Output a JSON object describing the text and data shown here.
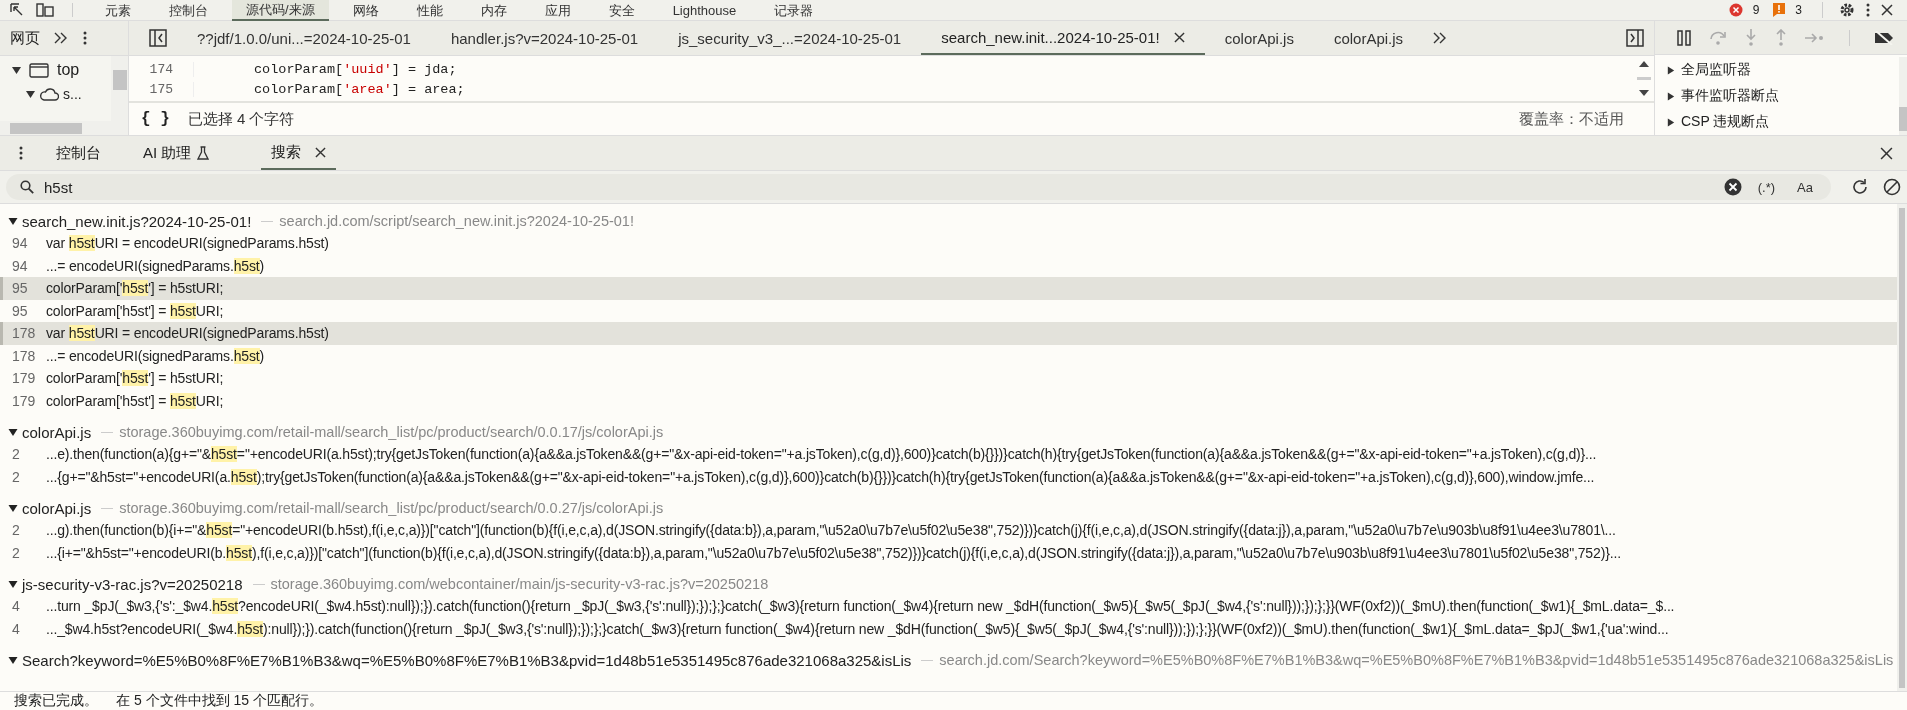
{
  "main_tabs": [
    {
      "label": "元素",
      "selected": false
    },
    {
      "label": "控制台",
      "selected": false
    },
    {
      "label": "源代码/来源",
      "selected": true
    },
    {
      "label": "网络",
      "selected": false
    },
    {
      "label": "性能",
      "selected": false
    },
    {
      "label": "内存",
      "selected": false
    },
    {
      "label": "应用",
      "selected": false
    },
    {
      "label": "安全",
      "selected": false
    },
    {
      "label": "Lighthouse",
      "selected": false
    },
    {
      "label": "记录器",
      "selected": false
    }
  ],
  "counters": {
    "errors": "9",
    "warnings": "3"
  },
  "navigator": {
    "tab": "网页",
    "tree": [
      {
        "label": "top",
        "expanded": true,
        "children": [
          {
            "label": "s...",
            "expanded": true
          }
        ]
      }
    ]
  },
  "file_tabs": [
    {
      "label": "??jdf/1.0.0/uni...=2024-10-25-01",
      "selected": false
    },
    {
      "label": "handler.js?v=2024-10-25-01",
      "selected": false
    },
    {
      "label": "js_security_v3_...=2024-10-25-01",
      "selected": false
    },
    {
      "label": "search_new.init...2024-10-25-01!",
      "selected": true
    },
    {
      "label": "colorApi.js",
      "selected": false
    },
    {
      "label": "colorApi.js",
      "selected": false
    }
  ],
  "editor": {
    "lines": [
      {
        "number": "174",
        "pre": "colorParam[",
        "str": "'uuid'",
        "post": "] = jda;"
      },
      {
        "number": "175",
        "pre": "colorParam[",
        "str": "'area'",
        "post": "] = area;"
      }
    ],
    "format_button": "{ }",
    "selection": "已选择 4 个字符",
    "coverage": "覆盖率：不适用"
  },
  "breakpoints": [
    {
      "label": "全局监听器",
      "expanded": false
    },
    {
      "label": "事件监听器断点",
      "expanded": false
    },
    {
      "label": "CSP 违规断点",
      "expanded": false
    }
  ],
  "drawer_tabs": [
    {
      "label": "控制台",
      "selected": false
    },
    {
      "label": "AI 助理",
      "selected": false
    },
    {
      "label": "搜索",
      "selected": true
    }
  ],
  "search": {
    "value": "h5st",
    "regex": "(.*)",
    "match_case": "Aa"
  },
  "results": [
    {
      "file": "search_new.init.js?2024-10-25-01!",
      "url": "search.jd.com/script/search_new.init.js?2024-10-25-01!",
      "expanded": true,
      "lines": [
        {
          "number": "94",
          "pre": "var ",
          "match": "h5st",
          "post": "URI = encodeURI(signedParams.h5st)",
          "selected": false
        },
        {
          "number": "94",
          "pre": "...= encodeURI(signedParams.",
          "match": "h5st",
          "post": ")",
          "selected": false
        },
        {
          "number": "95",
          "pre": "colorParam['",
          "match": "h5st",
          "post": "'] = h5stURI;",
          "selected": true
        },
        {
          "number": "95",
          "pre": "colorParam['h5st'] = ",
          "match": "h5st",
          "post": "URI;",
          "selected": false
        },
        {
          "number": "178",
          "pre": "var ",
          "match": "h5st",
          "post": "URI = encodeURI(signedParams.h5st)",
          "selected": true
        },
        {
          "number": "178",
          "pre": "...= encodeURI(signedParams.",
          "match": "h5st",
          "post": ")",
          "selected": false
        },
        {
          "number": "179",
          "pre": "colorParam['",
          "match": "h5st",
          "post": "'] = h5stURI;",
          "selected": false
        },
        {
          "number": "179",
          "pre": "colorParam['h5st'] = ",
          "match": "h5st",
          "post": "URI;",
          "selected": false
        }
      ]
    },
    {
      "file": "colorApi.js",
      "url": "storage.360buyimg.com/retail-mall/search_list/pc/product/search/0.0.17/js/colorApi.js",
      "expanded": true,
      "lines": [
        {
          "number": "2",
          "pre": "...e).then(function(a){g+=\"&",
          "match": "h5st",
          "post": "=\"+encodeURI(a.h5st);try{getJsToken(function(a){a&&a.jsToken&&(g+=\"&x-api-eid-token=\"+a.jsToken),c(g,d)},600)}catch(b){}})}catch(h){try{getJsToken(function(a){a&&a.jsToken&&(g+=\"&x-api-eid-token=\"+a.jsToken),c(g,d)}...",
          "selected": false
        },
        {
          "number": "2",
          "pre": "...{g+=\"&h5st=\"+encodeURI(a.",
          "match": "h5st",
          "post": ");try{getJsToken(function(a){a&&a.jsToken&&(g+=\"&x-api-eid-token=\"+a.jsToken),c(g,d)},600)}catch(b){}})}catch(h){try{getJsToken(function(a){a&&a.jsToken&&(g+=\"&x-api-eid-token=\"+a.jsToken),c(g,d)},600),window.jmfe...",
          "selected": false
        }
      ]
    },
    {
      "file": "colorApi.js",
      "url": "storage.360buyimg.com/retail-mall/search_list/pc/product/search/0.0.27/js/colorApi.js",
      "expanded": true,
      "lines": [
        {
          "number": "2",
          "pre": "...g).then(function(b){i+=\"&",
          "match": "h5st",
          "post": "=\"+encodeURI(b.h5st),f(i,e,c,a)})[\"catch\"](function(b){f(i,e,c,a),d(JSON.stringify({data:b}),a,param,\"\\u52a0\\u7b7e\\u5f02\\u5e38\",752)})}catch(j){f(i,e,c,a),d(JSON.stringify({data:j}),a,param,\"\\u52a0\\u7b7e\\u903b\\u8f91\\u4ee3\\u7801\\...",
          "selected": false
        },
        {
          "number": "2",
          "pre": "...{i+=\"&h5st=\"+encodeURI(b.",
          "match": "h5st",
          "post": "),f(i,e,c,a)})[\"catch\"](function(b){f(i,e,c,a),d(JSON.stringify({data:b}),a,param,\"\\u52a0\\u7b7e\\u5f02\\u5e38\",752)})}catch(j){f(i,e,c,a),d(JSON.stringify({data:j}),a,param,\"\\u52a0\\u7b7e\\u903b\\u8f91\\u4ee3\\u7801\\u5f02\\u5e38\",752)}...",
          "selected": false
        }
      ]
    },
    {
      "file": "js-security-v3-rac.js?v=20250218",
      "url": "storage.360buyimg.com/webcontainer/main/js-security-v3-rac.js?v=20250218",
      "expanded": true,
      "lines": [
        {
          "number": "4",
          "pre": "...turn _$pJ(_$w3,{'s':_$w4.",
          "match": "h5st",
          "post": "?encodeURI(_$w4.h5st):null});}).catch(function(){return _$pJ(_$w3,{'s':null});});};}catch(_$w3){return function(_$w4){return new _$dH(function(_$w5){_$w5(_$pJ(_$w4,{'s':null}));});};}}(WF(0xf2))(_$mU).then(function(_$w1){_$mL.data=_$...",
          "selected": false
        },
        {
          "number": "4",
          "pre": "..._$w4.h5st?encodeURI(_$w4.",
          "match": "h5st",
          "post": "):null});}).catch(function(){return _$pJ(_$w3,{'s':null});});};}catch(_$w3){return function(_$w4){return new _$dH(function(_$w5){_$w5(_$pJ(_$w4,{'s':null}));});};}}(WF(0xf2))(_$mU).then(function(_$w1){_$mL.data=_$pJ(_$w1,{'ua':wind...",
          "selected": false
        }
      ]
    },
    {
      "file": "Search?keyword=%E5%B0%8F%E7%B1%B3&wq=%E5%B0%8F%E7%B1%B3&pvid=1d48b51e5351495c876ade321068a325&isLis",
      "url": "search.jd.com/Search?keyword=%E5%B0%8F%E7%B1%B3&wq=%E5%B0%8F%E7%B1%B3&pvid=1d48b51e5351495c876ade321068a325&isLis",
      "expanded": true
    }
  ],
  "status": {
    "done": "搜索已完成。",
    "summary": "在 5 个文件中找到 15 个匹配行。"
  }
}
